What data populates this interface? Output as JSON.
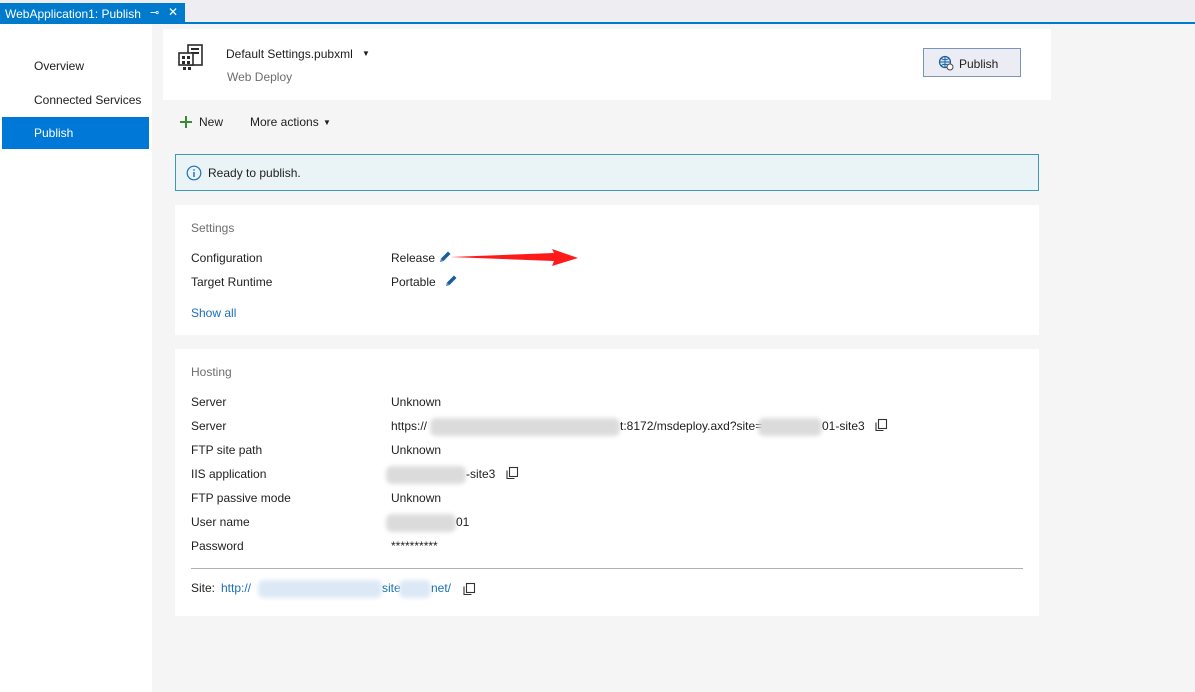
{
  "tab": {
    "title": "WebApplication1: Publish",
    "pin": "⊸",
    "close": "✕"
  },
  "nav": {
    "items": [
      "Overview",
      "Connected Services",
      "Publish"
    ],
    "active": "Publish"
  },
  "profile": {
    "name": "Default Settings.pubxml",
    "method": "Web Deploy",
    "publish_button": "Publish"
  },
  "toolbar": {
    "new": "New",
    "more_actions": "More actions"
  },
  "status": {
    "message": "Ready to publish."
  },
  "settings": {
    "title": "Settings",
    "rows": [
      {
        "label": "Configuration",
        "value": "Release"
      },
      {
        "label": "Target Runtime",
        "value": "Portable"
      }
    ],
    "show_all": "Show all"
  },
  "hosting": {
    "title": "Hosting",
    "rows": [
      {
        "label": "Server",
        "value": "Unknown"
      },
      {
        "label": "Server",
        "value_prefix": "https://",
        "value_mid": "t:8172/msdeploy.axd?site=",
        "value_suffix": "01-site3"
      },
      {
        "label": "FTP site path",
        "value": "Unknown"
      },
      {
        "label": "IIS application",
        "value": "-site3"
      },
      {
        "label": "FTP passive mode",
        "value": "Unknown"
      },
      {
        "label": "User name",
        "value": "01"
      },
      {
        "label": "Password",
        "value": "**********"
      }
    ],
    "site_label": "Site:",
    "site_prefix": "http://",
    "site_mid": "site",
    "site_suffix": "net/"
  },
  "colors": {
    "accent": "#007acc",
    "nav_active": "#0078d7",
    "link": "#1a6fb8",
    "status_border": "#3e9ab0",
    "annotation_arrow": "#ff1a1a"
  }
}
